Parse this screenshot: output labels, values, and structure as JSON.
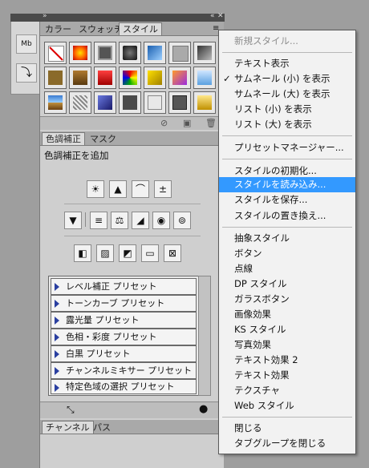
{
  "dock": {
    "buttons": [
      {
        "icon": "mb-icon",
        "glyph": "Mb"
      },
      {
        "icon": "history-arrow-icon",
        "glyph": "⤵"
      }
    ]
  },
  "panel": {
    "top_tabs": [
      {
        "label": "カラー"
      },
      {
        "label": "スウォッチ"
      },
      {
        "label": "スタイル",
        "active": true
      }
    ],
    "adjust_tabs": [
      {
        "label": "色調補正",
        "active": true
      },
      {
        "label": "マスク"
      }
    ],
    "adjust_title": "色調補正を追加",
    "presets": [
      "レベル補正 プリセット",
      "トーンカーブ プリセット",
      "露光量 プリセット",
      "色相・彩度 プリセット",
      "白黒 プリセット",
      "チャンネルミキサー プリセット",
      "特定色域の選択 プリセット"
    ],
    "bottom_tabs": [
      {
        "label": "チャンネル",
        "active": true
      },
      {
        "label": "パス"
      }
    ]
  },
  "menu": {
    "items": [
      {
        "label": "新規スタイル...",
        "disabled": true
      },
      {
        "sep": true
      },
      {
        "label": "テキスト表示"
      },
      {
        "label": "サムネール (小) を表示",
        "checked": true
      },
      {
        "label": "サムネール (大) を表示"
      },
      {
        "label": "リスト (小) を表示"
      },
      {
        "label": "リスト (大) を表示"
      },
      {
        "sep": true
      },
      {
        "label": "プリセットマネージャー..."
      },
      {
        "sep": true
      },
      {
        "label": "スタイルの初期化..."
      },
      {
        "label": "スタイルを読み込み...",
        "highlight": true
      },
      {
        "label": "スタイルを保存..."
      },
      {
        "label": "スタイルの置き換え..."
      },
      {
        "sep": true
      },
      {
        "label": "抽象スタイル"
      },
      {
        "label": "ボタン"
      },
      {
        "label": "点線"
      },
      {
        "label": "DP スタイル"
      },
      {
        "label": "ガラスボタン"
      },
      {
        "label": "画像効果"
      },
      {
        "label": "KS スタイル"
      },
      {
        "label": "写真効果"
      },
      {
        "label": "テキスト効果 2"
      },
      {
        "label": "テキスト効果"
      },
      {
        "label": "テクスチャ"
      },
      {
        "label": "Web スタイル"
      },
      {
        "sep": true
      },
      {
        "label": "閉じる"
      },
      {
        "label": "タブグループを閉じる"
      }
    ],
    "check_glyph": "✓",
    "highlight_color": "#3399ff"
  }
}
